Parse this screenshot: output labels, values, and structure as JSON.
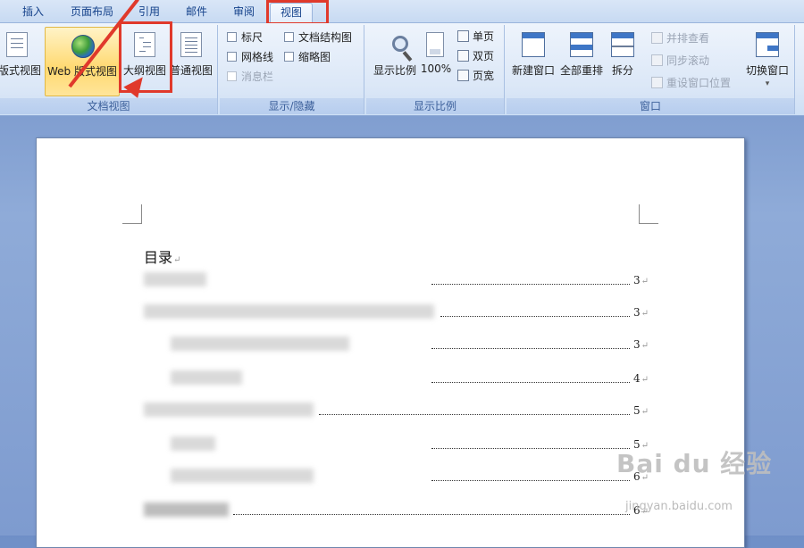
{
  "tabs": [
    {
      "label": "插入"
    },
    {
      "label": "页面布局"
    },
    {
      "label": "引用"
    },
    {
      "label": "邮件"
    },
    {
      "label": "审阅"
    },
    {
      "label": "视图"
    }
  ],
  "active_tab": "视图",
  "highlight_color": "#e0392b",
  "ribbon": {
    "doc_views": {
      "label": "文档视图",
      "buttons": [
        {
          "label": "版式视图"
        },
        {
          "label": "Web 版式视图"
        },
        {
          "label": "大纲视图"
        },
        {
          "label": "普通视图"
        }
      ]
    },
    "show_hide": {
      "label": "显示/隐藏",
      "items": [
        {
          "label": "标尺"
        },
        {
          "label": "网格线"
        },
        {
          "label": "消息栏"
        },
        {
          "label": "文档结构图"
        },
        {
          "label": "缩略图"
        }
      ]
    },
    "zoom": {
      "label": "显示比例",
      "zoom_button": "显示比例",
      "hundred_button": "100%",
      "page_options": [
        {
          "label": "单页"
        },
        {
          "label": "双页"
        },
        {
          "label": "页宽"
        }
      ]
    },
    "window": {
      "label": "窗口",
      "new_window": "新建窗口",
      "arrange_all": "全部重排",
      "split": "拆分",
      "side_by_side": "并排查看",
      "sync_scroll": "同步滚动",
      "reset_position": "重设窗口位置",
      "switch_window": "切换窗口"
    }
  },
  "document": {
    "toc_title": "目录",
    "toc_entries": [
      {
        "page": "3"
      },
      {
        "page": "3"
      },
      {
        "page": "3"
      },
      {
        "page": "4"
      },
      {
        "page": "5"
      },
      {
        "page": "5"
      },
      {
        "page": "6"
      },
      {
        "page": "6"
      }
    ]
  },
  "watermark": {
    "brand": "Bai du 经验",
    "url": "jingyan.baidu.com"
  }
}
